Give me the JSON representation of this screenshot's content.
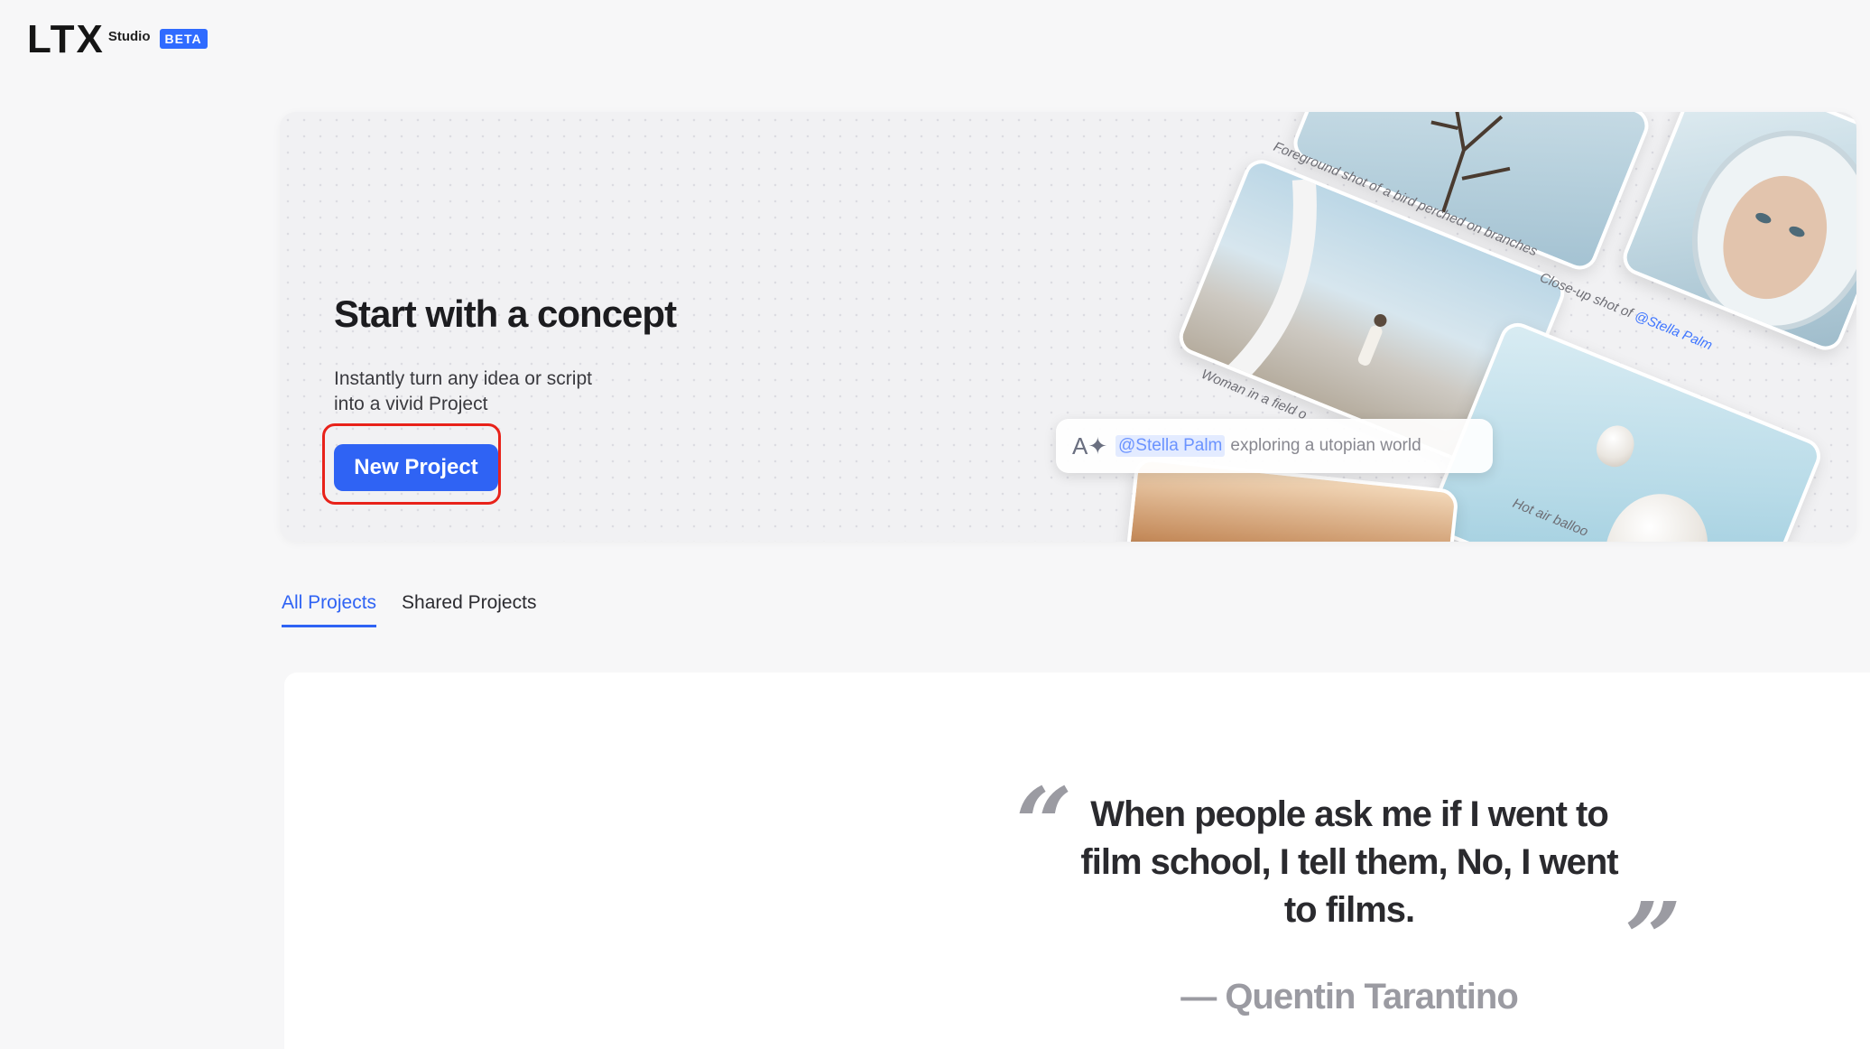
{
  "header": {
    "logo_mark": "LTX",
    "logo_studio": "Studio",
    "logo_badge": "BETA"
  },
  "hero": {
    "title": "Start with a concept",
    "subtitle": "Instantly turn any idea or script into a vivid Project",
    "new_project_label": "New Project",
    "captions": {
      "bird": "Foreground shot of a bird perched on branches",
      "closeup_prefix": "Close-up shot of",
      "closeup_mention": "@Stella Palm",
      "woman": "Woman in a field o",
      "balloon": "Hot air balloo"
    },
    "prompt": {
      "icon": "ai-text-icon",
      "mention": "@Stella Palm",
      "text": "exploring a utopian world"
    }
  },
  "tabs": [
    {
      "label": "All Projects",
      "active": true
    },
    {
      "label": "Shared Projects",
      "active": false
    }
  ],
  "quote": {
    "open_mark": "“",
    "text": "When people ask me if I went to film school, I tell them, No, I went to films.",
    "close_mark": "”",
    "author": "— Quentin Tarantino"
  },
  "colors": {
    "accent": "#2f63f4",
    "highlight_border": "#e8221a",
    "badge": "#2f6bff"
  }
}
